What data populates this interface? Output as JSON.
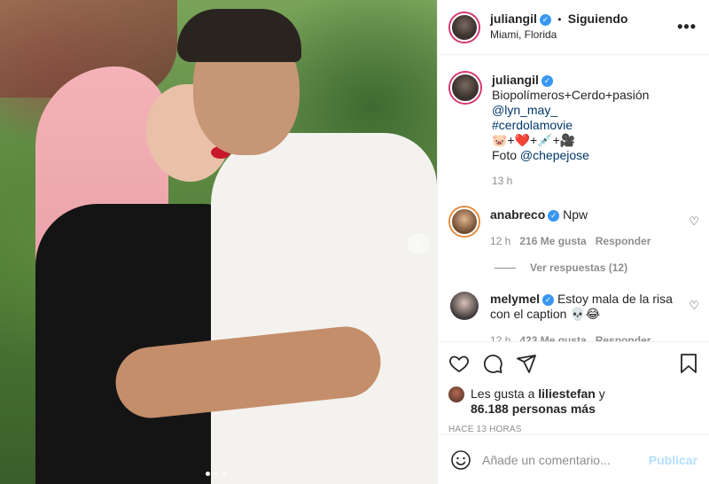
{
  "header": {
    "username": "juliangil",
    "separator": "•",
    "follow_label": "Siguiendo",
    "location": "Miami, Florida",
    "more_icon": "more-horizontal-icon"
  },
  "post": {
    "username": "juliangil",
    "caption_line1": "Biopolímeros+Cerdo+pasión",
    "mention": "@lyn_may_",
    "hashtag": "#cerdolamovie",
    "emoji_line": "🐷+❤️+💉+🎥",
    "photo_credit_prefix": "Foto",
    "photo_credit_user": "@chepejose",
    "time": "13 h"
  },
  "comments": [
    {
      "username": "anabreco",
      "text": "Npw",
      "time": "12 h",
      "likes": "216 Me gusta",
      "reply_label": "Responder",
      "view_replies": "Ver respuestas (12)"
    },
    {
      "username": "melymel",
      "text": "Estoy mala de la risa con el caption 💀😂",
      "time": "12 h",
      "likes": "423 Me gusta",
      "reply_label": "Responder"
    }
  ],
  "likes": {
    "prefix": "Les gusta a",
    "user": "liliestefan",
    "connector": "y",
    "count": "86.188 personas más"
  },
  "timestamp": "HACE 13 HORAS",
  "add_comment": {
    "placeholder": "Añade un comentario...",
    "publish_label": "Publicar"
  },
  "colors": {
    "verified": "#3897f0",
    "link": "#00376b",
    "muted": "#8e8e8e",
    "publish_disabled": "#b2dffc"
  }
}
